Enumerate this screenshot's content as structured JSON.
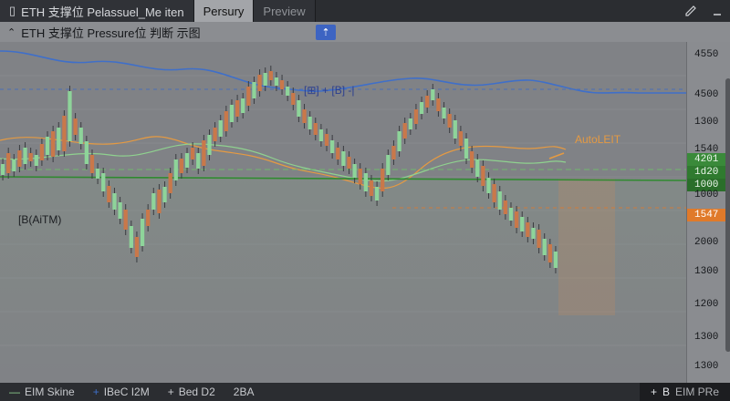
{
  "tabs": [
    {
      "label": "ETH 支撑位 Pelassuel_Me iten",
      "icon": "▯"
    },
    {
      "label": "Persury"
    },
    {
      "label": "Preview"
    }
  ],
  "toolbar": {
    "draw_icon": "pen-icon",
    "min_icon": "minimize-icon"
  },
  "chart_title": "ETH 支撑位 Pressure位 判断 示图",
  "annotations": {
    "top_center": "[⊞] + [B] -|",
    "left_label": "[B(AiTM)",
    "right_label": "AutoLEIT"
  },
  "price_axis": {
    "labels": [
      "4550",
      "4500",
      "1300",
      "1540",
      "1000",
      "2000",
      "1300",
      "1200",
      "1300",
      "1300"
    ],
    "badges": [
      {
        "text": "4201",
        "color": "#3a8a3a"
      },
      {
        "text": "1d20",
        "color": "#2f7a2f"
      },
      {
        "text": "1000",
        "color": "#2a6e2a"
      },
      {
        "text": "1547",
        "color": "#e07a2a"
      }
    ]
  },
  "bottom": {
    "items": [
      {
        "icon": "—",
        "label": "EIM Skine"
      },
      {
        "icon": "+",
        "label": "IBeC I2M"
      },
      {
        "icon": "+",
        "label": "Bed D2"
      },
      {
        "icon": "",
        "label": "2BA"
      }
    ],
    "right": {
      "icon": "+",
      "label1": "B",
      "label2": "EIM PRe"
    }
  },
  "chart_data": {
    "type": "candlestick",
    "candles": [
      [
        1,
        188,
        200
      ],
      [
        0,
        190,
        212
      ],
      [
        1,
        192,
        205
      ],
      [
        0,
        197,
        215
      ],
      [
        1,
        200,
        218
      ],
      [
        0,
        203,
        212
      ],
      [
        1,
        198,
        210
      ],
      [
        0,
        204,
        222
      ],
      [
        1,
        210,
        230
      ],
      [
        0,
        208,
        236
      ],
      [
        1,
        215,
        240
      ],
      [
        0,
        214,
        253
      ],
      [
        1,
        225,
        280
      ],
      [
        0,
        232,
        250
      ],
      [
        1,
        222,
        240
      ],
      [
        1,
        200,
        225
      ],
      [
        0,
        190,
        210
      ],
      [
        1,
        184,
        195
      ],
      [
        1,
        170,
        190
      ],
      [
        0,
        158,
        176
      ],
      [
        1,
        150,
        168
      ],
      [
        1,
        140,
        158
      ],
      [
        0,
        128,
        150
      ],
      [
        1,
        108,
        132
      ],
      [
        0,
        98,
        120
      ],
      [
        1,
        110,
        140
      ],
      [
        0,
        132,
        150
      ],
      [
        1,
        150,
        168
      ],
      [
        0,
        146,
        172
      ],
      [
        1,
        158,
        175
      ],
      [
        0,
        168,
        190
      ],
      [
        1,
        182,
        205
      ],
      [
        0,
        190,
        206
      ],
      [
        1,
        196,
        212
      ],
      [
        0,
        205,
        218
      ],
      [
        1,
        195,
        212
      ],
      [
        0,
        198,
        226
      ],
      [
        1,
        210,
        232
      ],
      [
        0,
        225,
        240
      ],
      [
        1,
        230,
        248
      ],
      [
        0,
        236,
        258
      ],
      [
        1,
        246,
        265
      ],
      [
        0,
        252,
        270
      ],
      [
        1,
        256,
        272
      ],
      [
        0,
        264,
        285
      ],
      [
        1,
        272,
        290
      ],
      [
        0,
        280,
        298
      ],
      [
        1,
        286,
        300
      ],
      [
        0,
        292,
        302
      ],
      [
        1,
        286,
        295
      ],
      [
        0,
        282,
        292
      ],
      [
        1,
        275,
        285
      ],
      [
        0,
        265,
        278
      ],
      [
        1,
        252,
        270
      ],
      [
        0,
        245,
        260
      ],
      [
        1,
        238,
        252
      ],
      [
        0,
        232,
        245
      ],
      [
        1,
        225,
        238
      ],
      [
        0,
        220,
        233
      ],
      [
        1,
        212,
        226
      ],
      [
        0,
        205,
        218
      ],
      [
        1,
        198,
        214
      ],
      [
        0,
        195,
        208
      ],
      [
        1,
        185,
        200
      ],
      [
        0,
        178,
        195
      ],
      [
        1,
        170,
        190
      ],
      [
        0,
        165,
        182
      ],
      [
        1,
        160,
        175
      ],
      [
        0,
        170,
        195
      ],
      [
        1,
        188,
        210
      ],
      [
        0,
        205,
        220
      ],
      [
        1,
        214,
        236
      ],
      [
        0,
        228,
        245
      ],
      [
        1,
        238,
        250
      ],
      [
        0,
        244,
        260
      ],
      [
        1,
        255,
        268
      ],
      [
        0,
        262,
        275
      ],
      [
        1,
        270,
        282
      ],
      [
        0,
        258,
        272
      ],
      [
        1,
        250,
        262
      ],
      [
        0,
        240,
        255
      ],
      [
        1,
        228,
        248
      ],
      [
        0,
        220,
        236
      ],
      [
        1,
        206,
        228
      ],
      [
        0,
        196,
        214
      ],
      [
        1,
        186,
        205
      ],
      [
        0,
        176,
        198
      ],
      [
        1,
        168,
        185
      ],
      [
        0,
        158,
        178
      ],
      [
        1,
        150,
        170
      ],
      [
        0,
        145,
        160
      ],
      [
        1,
        138,
        152
      ],
      [
        0,
        130,
        148
      ],
      [
        1,
        126,
        142
      ],
      [
        0,
        120,
        136
      ],
      [
        1,
        118,
        130
      ],
      [
        0,
        108,
        128
      ],
      [
        1,
        100,
        118
      ],
      [
        0,
        92,
        112
      ],
      [
        1,
        86,
        104
      ]
    ]
  }
}
